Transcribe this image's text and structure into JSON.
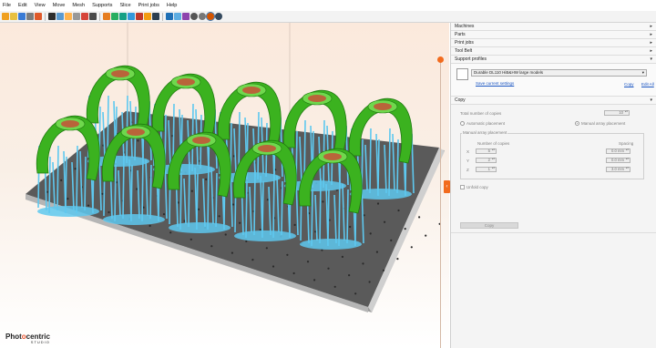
{
  "menu": [
    "File",
    "Edit",
    "View",
    "Move",
    "Mesh",
    "Supports",
    "Slice",
    "Print jobs",
    "Help"
  ],
  "toolbar_icons": [
    "new-icon",
    "open-icon",
    "save-icon",
    "folder-icon",
    "print-icon",
    "undo-icon",
    "redo-icon",
    "cut-icon",
    "copy-icon",
    "paste-icon",
    "delete-icon",
    "select-icon",
    "move-icon",
    "rotate-icon",
    "scale-icon",
    "mirror-icon",
    "support-icon",
    "slice-icon",
    "view-top-icon",
    "view-front-icon",
    "view-side-icon",
    "grid-icon",
    "measure-icon",
    "record-icon",
    "settings-icon"
  ],
  "panel": {
    "sections": [
      {
        "label": "Machines",
        "arrow": "▸"
      },
      {
        "label": "Parts",
        "arrow": "▸"
      },
      {
        "label": "Print jobs",
        "arrow": "▸"
      },
      {
        "label": "Tool Belt",
        "arrow": "▸"
      },
      {
        "label": "Support profiles",
        "arrow": "▾"
      }
    ],
    "profile": {
      "selected": "Durable DL110 HiB&HW large models",
      "save_link": "Save current settings",
      "copy_link": "Copy",
      "edit_link": "Edit All"
    },
    "copy": {
      "header": "Copy",
      "total_label": "Total number of copies",
      "total_value": "10",
      "auto_label": "Automatic placement",
      "manual_label": "Manual array placement",
      "group_label": "Manual array placement",
      "num_copies_label": "Number of copies",
      "spacing_label": "Spacing",
      "axes": [
        {
          "axis": "X",
          "copies": "5",
          "spacing": "0.0 mm"
        },
        {
          "axis": "Y",
          "copies": "2",
          "spacing": "0.0 mm"
        },
        {
          "axis": "Z",
          "copies": "1",
          "spacing": "3.0 mm"
        }
      ],
      "unfold_label": "Unfold copy",
      "button": "Copy"
    }
  },
  "logo": {
    "text_a": "Phot",
    "text_o": "o",
    "text_b": "centric",
    "studio": "STUDIO"
  },
  "colors": {
    "accent": "#f26b1d",
    "model": "#3bb21f",
    "support": "#5ec8ef",
    "plate": "#555555"
  }
}
